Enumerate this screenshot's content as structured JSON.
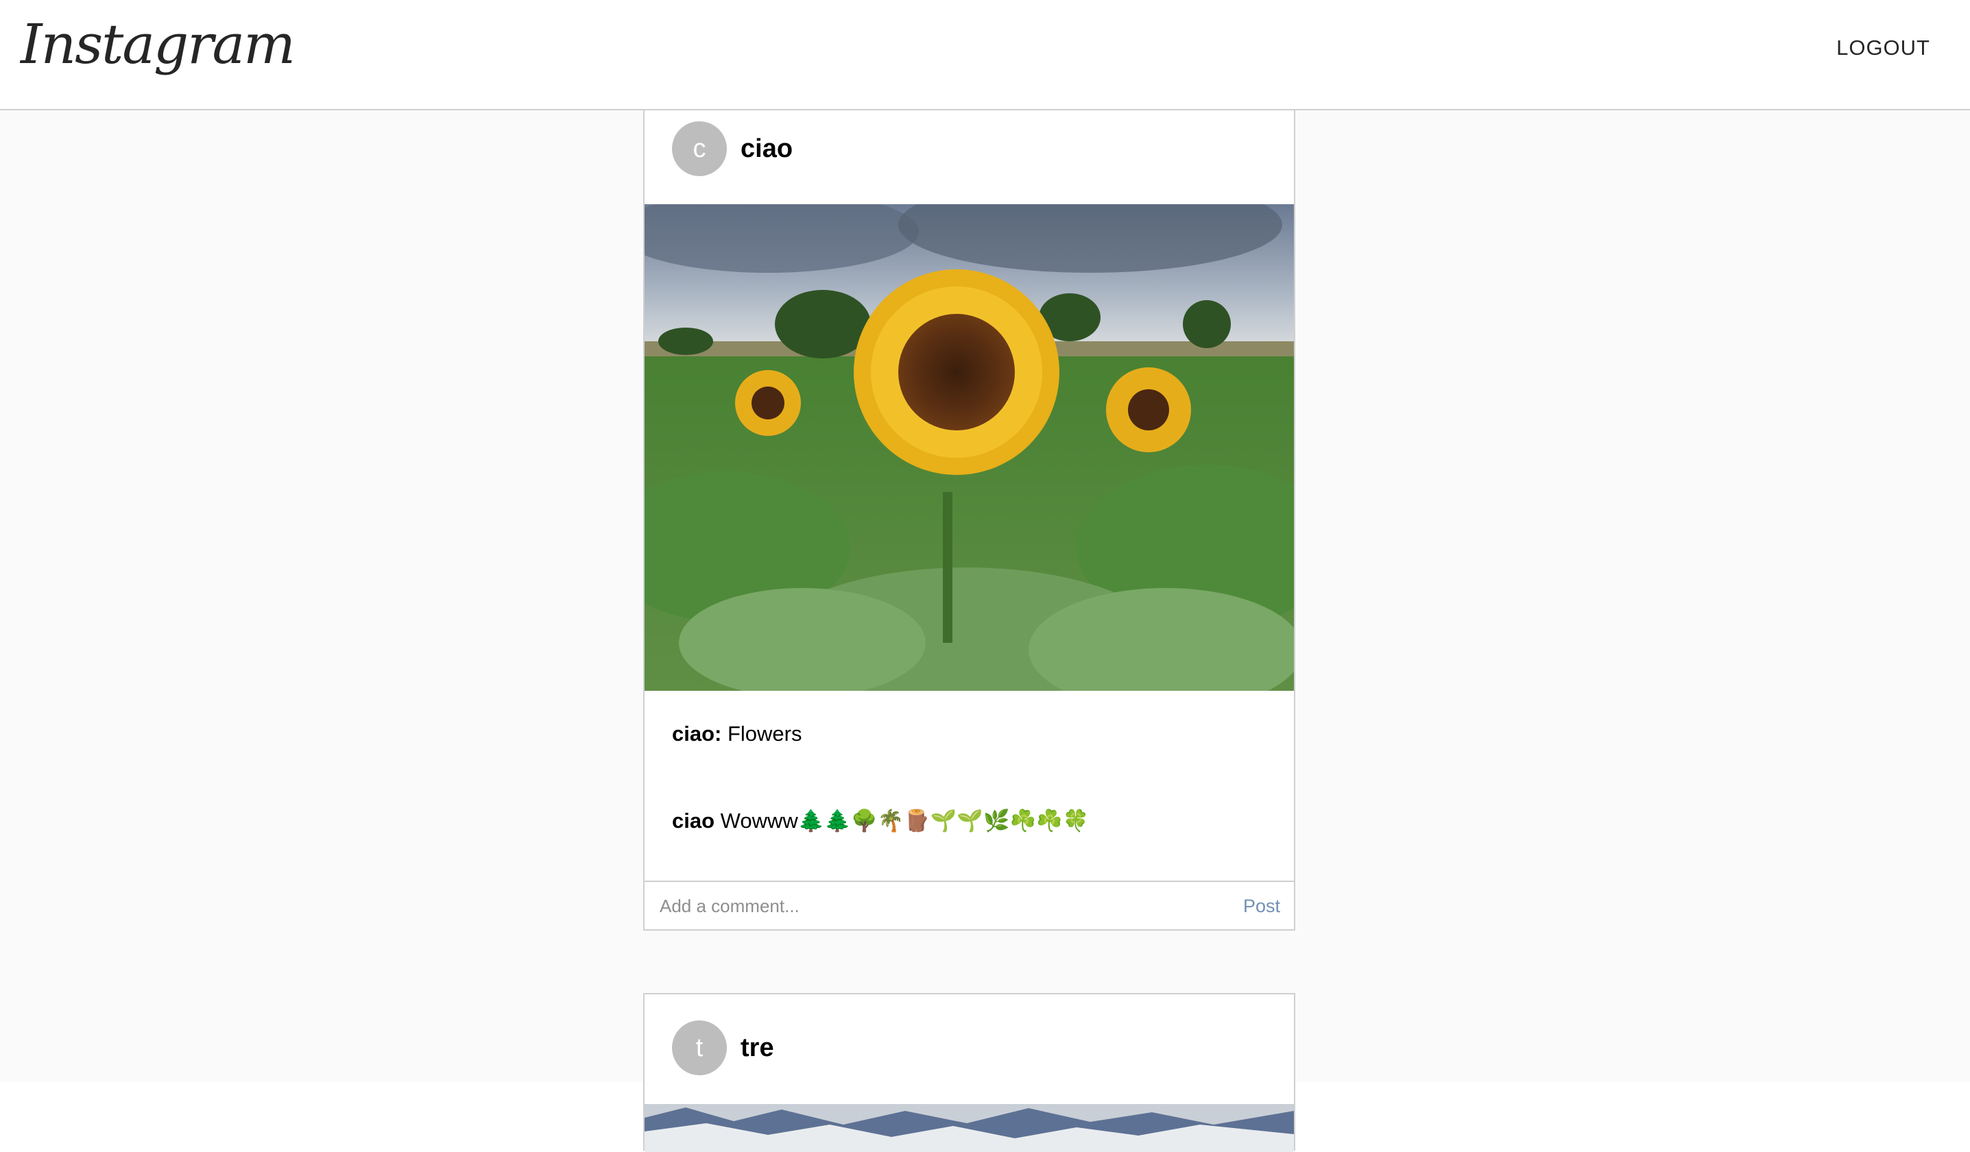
{
  "header": {
    "logo_text": "Instagram",
    "logout_label": "LOGOUT"
  },
  "posts": [
    {
      "avatar_letter": "c",
      "username": "ciao",
      "image_description": "sunflower field",
      "caption_user": "ciao:",
      "caption_text": "Flowers",
      "comments": [
        {
          "user": "ciao",
          "text": "Wowww🌲🌲🌳🌴🪵🌱🌱🌿☘️☘️🍀"
        }
      ],
      "comment_placeholder": "Add a comment...",
      "post_label": "Post"
    },
    {
      "avatar_letter": "t",
      "username": "tre"
    }
  ],
  "colors": {
    "feed_background": "#fafafa",
    "border": "#cfcfcf",
    "avatar": "#bdbdbd",
    "post_button": "#7290b5"
  }
}
